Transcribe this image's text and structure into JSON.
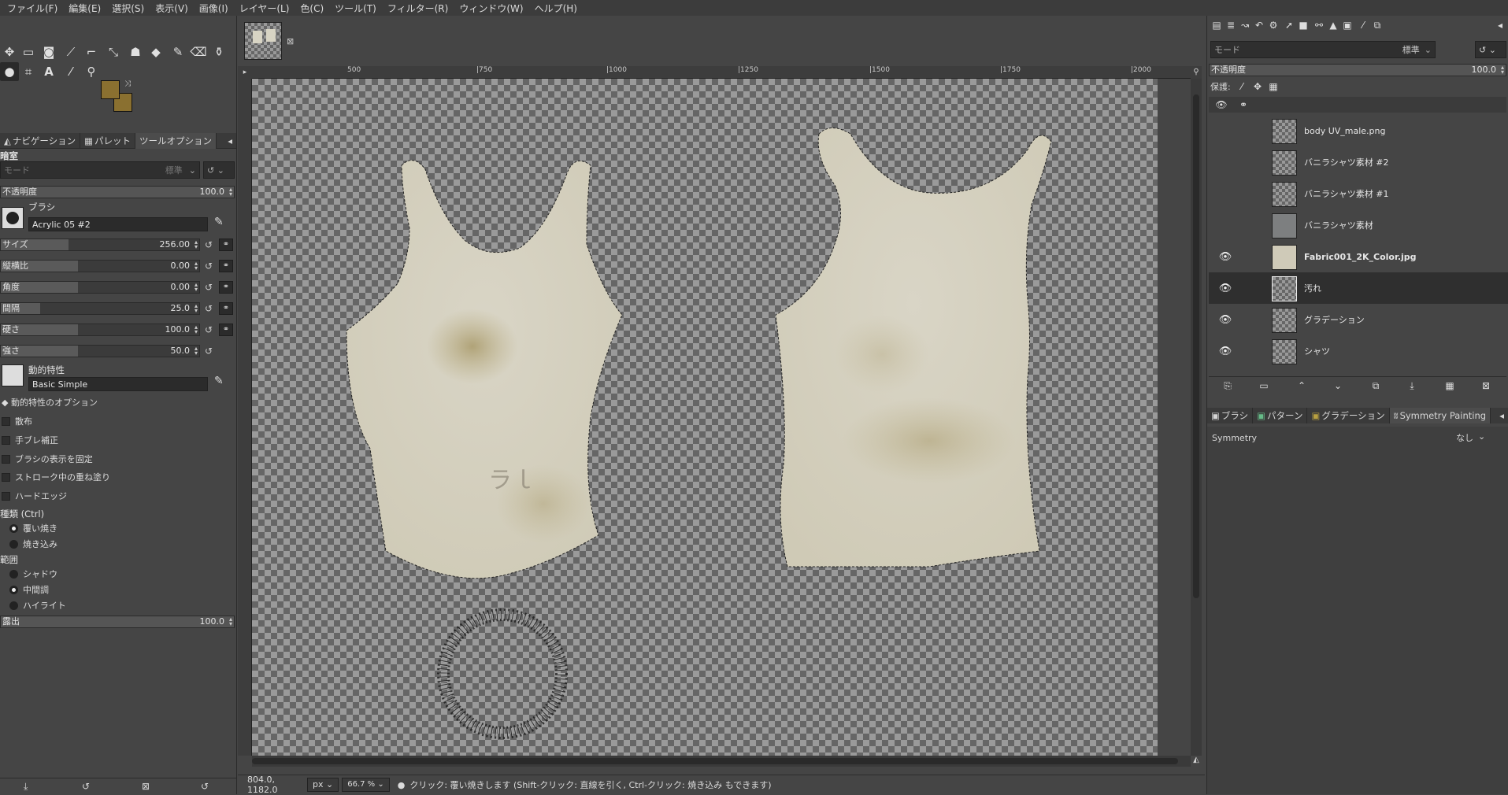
{
  "menubar": [
    "ファイル(F)",
    "編集(E)",
    "選択(S)",
    "表示(V)",
    "画像(I)",
    "レイヤー(L)",
    "色(C)",
    "ツール(T)",
    "フィルター(R)",
    "ウィンドウ(W)",
    "ヘルプ(H)"
  ],
  "colors": {
    "foreground": "#8a7030",
    "background": "#8a7030",
    "accent": "#2f2f2f"
  },
  "left": {
    "tabs": [
      "ナビゲーション",
      "パレット",
      "ツールオプション"
    ],
    "tool_title": "暗室",
    "mode_label": "モード",
    "mode_value": "標準",
    "opacity_label": "不透明度",
    "opacity_value": "100.0",
    "brush_label": "ブラシ",
    "brush_name": "Acrylic 05 #2",
    "sliders": [
      {
        "label": "サイズ",
        "value": "256.00",
        "fill": 0.34
      },
      {
        "label": "縦横比",
        "value": "0.00",
        "fill": 0.39
      },
      {
        "label": "角度",
        "value": "0.00",
        "fill": 0.39
      },
      {
        "label": "間隔",
        "value": "25.0",
        "fill": 0.2
      },
      {
        "label": "硬さ",
        "value": "100.0",
        "fill": 0.39
      },
      {
        "label": "強さ",
        "value": "50.0",
        "fill": 0.39
      }
    ],
    "dynamics_label": "動的特性",
    "dynamics_value": "Basic Simple",
    "dynamics_options": "動的特性のオプション",
    "checks": [
      "散布",
      "手ブレ補正",
      "ブラシの表示を固定",
      "ストローク中の重ね塗り",
      "ハードエッジ"
    ],
    "type_label": "種類 (Ctrl)",
    "type_options": [
      "覆い焼き",
      "焼き込み"
    ],
    "range_label": "範囲",
    "range_options": [
      "シャドウ",
      "中間調",
      "ハイライト"
    ],
    "exposure_label": "露出",
    "exposure_value": "100.0"
  },
  "canvas": {
    "ruler_ticks": [
      "500",
      "|750",
      "|1000",
      "|1250",
      "|1500",
      "|1750",
      "|2000"
    ]
  },
  "status": {
    "coords": "804.0, 1182.0",
    "unit": "px",
    "zoom": "66.7 %",
    "message": "クリック: 覆い焼きします (Shift-クリック: 直線を引く, Ctrl-クリック: 焼き込み もできます)"
  },
  "right": {
    "mode_label": "モード",
    "mode_value": "標準",
    "opacity_label": "不透明度",
    "opacity_value": "100.0",
    "lock_label": "保護:",
    "layers": [
      {
        "name": "body UV_male.png",
        "visible": false,
        "bold": false
      },
      {
        "name": "バニラシャツ素材 #2",
        "visible": false,
        "bold": false
      },
      {
        "name": "バニラシャツ素材 #1",
        "visible": false,
        "bold": false
      },
      {
        "name": "バニラシャツ素材",
        "visible": false,
        "bold": false
      },
      {
        "name": "Fabric001_2K_Color.jpg",
        "visible": true,
        "bold": true
      },
      {
        "name": "汚れ",
        "visible": true,
        "bold": false
      },
      {
        "name": "グラデーション",
        "visible": true,
        "bold": false
      },
      {
        "name": "シャツ",
        "visible": true,
        "bold": false
      }
    ],
    "bottom_tabs": [
      "ブラシ",
      "パターン",
      "グラデーション",
      "Symmetry Painting"
    ],
    "symmetry_label": "Symmetry",
    "symmetry_value": "なし"
  }
}
